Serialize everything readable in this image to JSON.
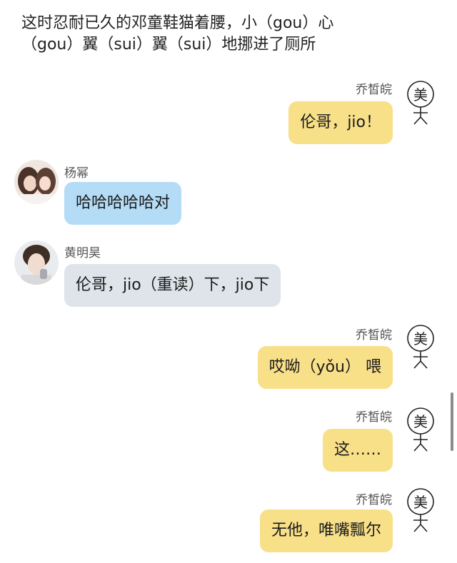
{
  "narration": "这时忍耐已久的邓童鞋猫着腰，小（gou）心\n（gou）翼（sui）翼（sui）地挪进了厕所",
  "messages": [
    {
      "sender": "乔皙皖",
      "text": "伦哥，jio！",
      "side": "right",
      "bubble_color": "#f8e089",
      "avatar_icon": "stick-figure-mei-icon"
    },
    {
      "sender": "杨幂",
      "text": "哈哈哈哈哈对",
      "side": "left",
      "bubble_color": "#b4dcf6",
      "avatar_icon": "avatar-photo-yangmi"
    },
    {
      "sender": "黄明昊",
      "text": "伦哥，jio（重读）下，jio下",
      "side": "left",
      "bubble_color": "#dfe4ea",
      "avatar_icon": "avatar-photo-huangminghao"
    },
    {
      "sender": "乔皙皖",
      "text": "哎呦（yǒu） 喂",
      "side": "right",
      "bubble_color": "#f8e089",
      "avatar_icon": "stick-figure-mei-icon"
    },
    {
      "sender": "乔皙皖",
      "text": "这……",
      "side": "right",
      "bubble_color": "#f8e089",
      "avatar_icon": "stick-figure-mei-icon"
    },
    {
      "sender": "乔皙皖",
      "text": "无他，唯嘴瓢尔",
      "side": "right",
      "bubble_color": "#f8e089",
      "avatar_icon": "stick-figure-mei-icon"
    }
  ],
  "stick_avatar_glyph": "美"
}
